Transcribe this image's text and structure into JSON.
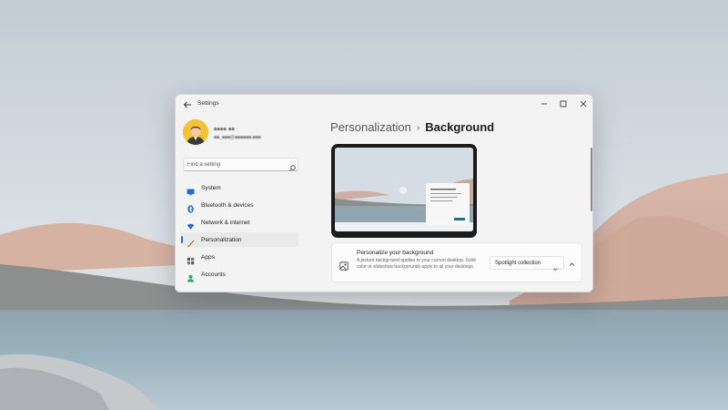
{
  "window": {
    "title": "Settings",
    "back_icon": "back-arrow-icon",
    "controls": [
      "minimize-icon",
      "maximize-icon",
      "close-icon"
    ]
  },
  "account": {
    "name": "■■■■ ■■",
    "email": "■■_■■■@■■■■■■.■■■"
  },
  "search": {
    "placeholder": "Find a setting",
    "icon": "search-icon"
  },
  "nav": {
    "items": [
      {
        "label": "System",
        "icon": "system-icon",
        "color": "#1a6fcf"
      },
      {
        "label": "Bluetooth & devices",
        "icon": "bluetooth-icon",
        "color": "#1a6fcf"
      },
      {
        "label": "Network & internet",
        "icon": "wifi-icon",
        "color": "#1a6fcf"
      },
      {
        "label": "Personalization",
        "icon": "brush-icon",
        "color": "#e08a3c"
      },
      {
        "label": "Apps",
        "icon": "apps-icon",
        "color": "#555555"
      },
      {
        "label": "Accounts",
        "icon": "person-icon",
        "color": "#2ea868"
      }
    ],
    "active": "Personalization"
  },
  "main": {
    "breadcrumb_parent": "Personalization",
    "breadcrumb_separator": "›",
    "breadcrumb_current": "Background",
    "card": {
      "title": "Personalize your background",
      "description": "A picture background applies to your current desktop. Solid color or slideshow backgrounds apply to all your desktops.",
      "icon": "picture-icon",
      "select_value": "Spotlight collection",
      "chevron_icon": "chevron-down-icon",
      "collapse_icon": "chevron-up-icon"
    }
  },
  "colors": {
    "accent": "#1a6fcf",
    "window_bg": "#f3f3f3"
  }
}
